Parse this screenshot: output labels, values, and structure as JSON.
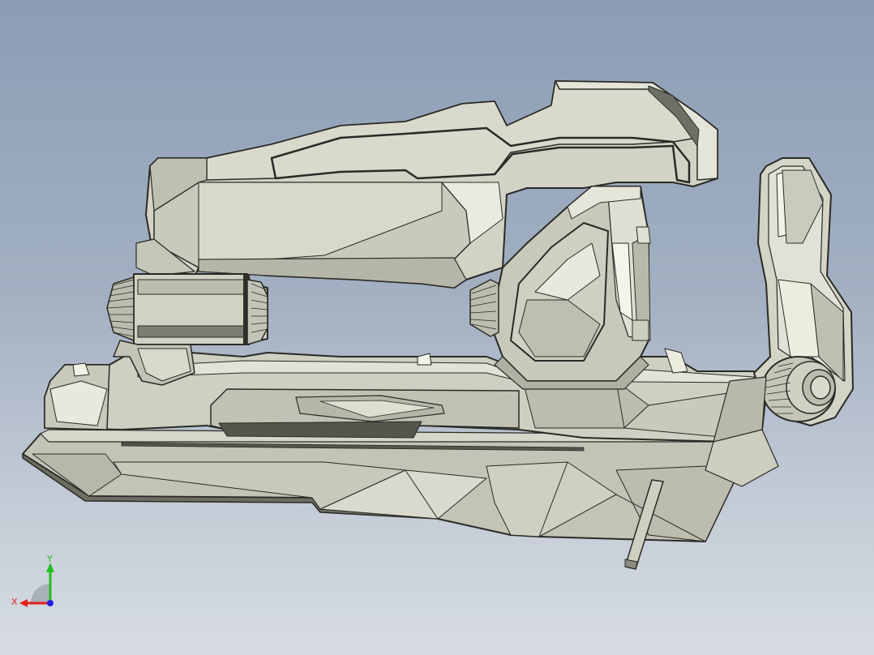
{
  "scene": {
    "model": "mechanical-blaster-part",
    "render_style": "shaded-with-edges",
    "colors": {
      "background_top": "#8b9db4",
      "background_bottom": "#d7dce3",
      "face_light": "#d6d6c9",
      "face_mid": "#c4c4b6",
      "face_dark": "#9c9c90",
      "face_highlight": "#eeeee2",
      "edge": "#2a2a26",
      "shadow_groove": "#55554d"
    }
  },
  "triad": {
    "x_label": "X",
    "y_label": "Y",
    "x_color": "#e02020",
    "y_color": "#20c020",
    "z_color": "#2020e0"
  }
}
